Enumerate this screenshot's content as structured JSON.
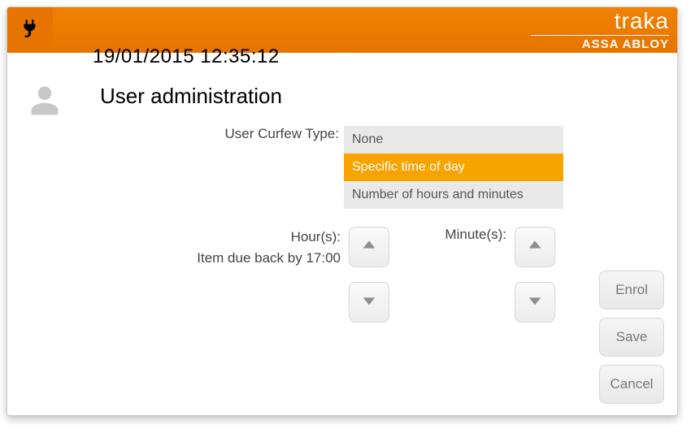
{
  "header": {
    "datetime": "19/01/2015 12:35:12",
    "brand_primary": "traka",
    "brand_secondary": "ASSA ABLOY"
  },
  "page": {
    "title": "User administration"
  },
  "form": {
    "curfew_type_label": "User Curfew Type:",
    "curfew_options": [
      {
        "label": "None",
        "selected": false
      },
      {
        "label": "Specific time of day",
        "selected": true
      },
      {
        "label": "Number of hours and minutes",
        "selected": false
      }
    ],
    "hours_label": "Hour(s):",
    "minutes_label": "Minute(s):",
    "due_back_text": "Item due back by 17:00"
  },
  "buttons": {
    "enrol": "Enrol",
    "save": "Save",
    "cancel": "Cancel"
  }
}
